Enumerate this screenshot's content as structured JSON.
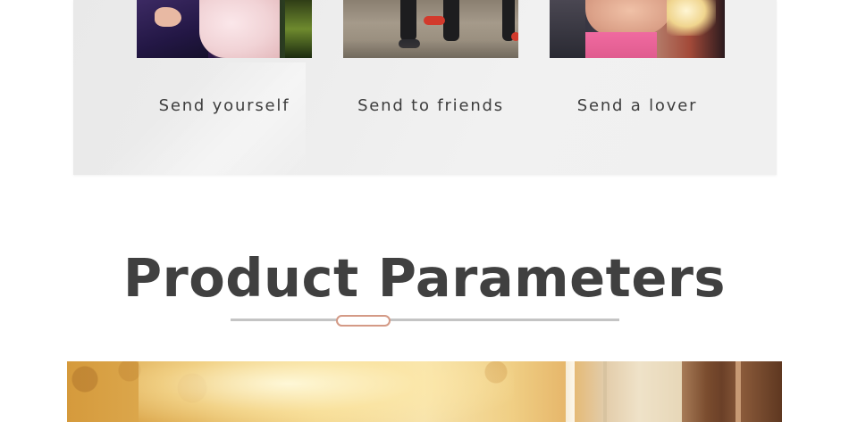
{
  "gift_section": {
    "cards": [
      {
        "caption": "Send yourself",
        "photo": "couple-embrace-photo"
      },
      {
        "caption": "Send to friends",
        "photo": "walking-feet-photo"
      },
      {
        "caption": "Send a lover",
        "photo": "lovers-hug-photo"
      }
    ]
  },
  "section": {
    "title": "Product Parameters"
  },
  "colors": {
    "title_text": "#404040",
    "caption_text": "#3d3d3d",
    "divider_line": "#c4c4c4",
    "divider_accent": "#d49a86",
    "panel_bg": "#eeeeee"
  }
}
